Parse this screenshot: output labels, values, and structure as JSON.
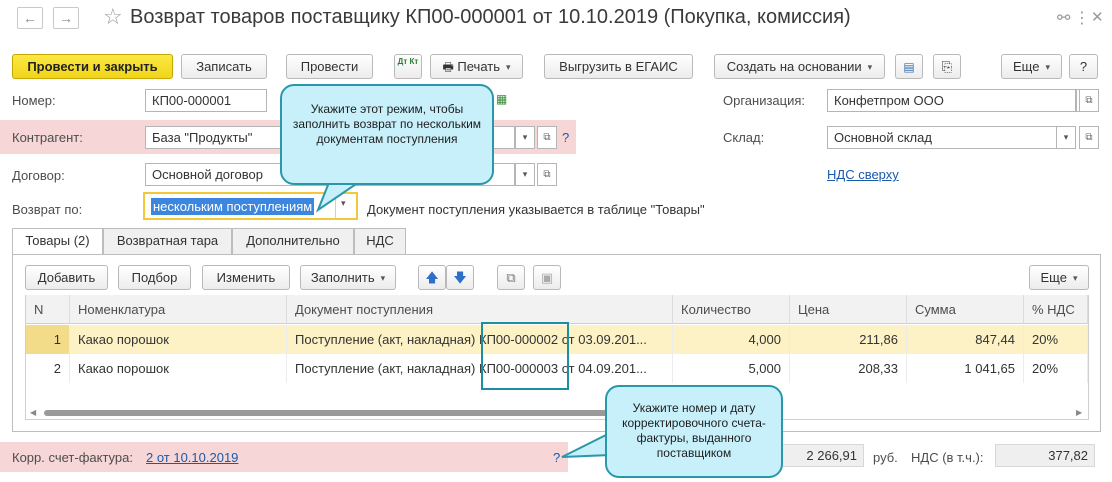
{
  "title": "Возврат товаров поставщику КП00-000001 от 10.10.2019 (Покупка, комиссия)",
  "toolbar": {
    "post_close": "Провести и закрыть",
    "save": "Записать",
    "post": "Провести",
    "dt_kt": "Дт Кт",
    "print": "Печать",
    "egais": "Выгрузить в ЕГАИС",
    "create_based": "Создать на основании",
    "more": "Еще",
    "help": "?"
  },
  "form": {
    "number_label": "Номер:",
    "number_value": "КП00-000001",
    "counterparty_label": "Контрагент:",
    "counterparty_value": "База \"Продукты\"",
    "contract_label": "Договор:",
    "contract_value": "Основной договор",
    "return_by_label": "Возврат по:",
    "return_by_value": "нескольким поступлениям",
    "return_by_hint": "Документ поступления указывается в таблице \"Товары\"",
    "org_label": "Организация:",
    "org_value": "Конфетпром ООО",
    "warehouse_label": "Склад:",
    "warehouse_value": "Основной склад",
    "vat_link": "НДС сверху"
  },
  "tabs": [
    "Товары (2)",
    "Возвратная тара",
    "Дополнительно",
    "НДС"
  ],
  "table_toolbar": {
    "add": "Добавить",
    "select": "Подбор",
    "edit": "Изменить",
    "fill": "Заполнить",
    "more": "Еще"
  },
  "table": {
    "headers": [
      "N",
      "Номенклатура",
      "Документ поступления",
      "Количество",
      "Цена",
      "Сумма",
      "% НДС"
    ],
    "rows": [
      {
        "n": "1",
        "item": "Какао порошок",
        "doc_prefix": "Поступление (акт, накладная)",
        "doc_number": "КП00-000002",
        "doc_suffix": "от 03.09.201...",
        "qty": "4,000",
        "price": "211,86",
        "sum": "847,44",
        "vat": "20%"
      },
      {
        "n": "2",
        "item": "Какао порошок",
        "doc_prefix": "Поступление (акт, накладная)",
        "doc_number": "КП00-000003",
        "doc_suffix": "от 04.09.201...",
        "qty": "5,000",
        "price": "208,33",
        "sum": "1 041,65",
        "vat": "20%"
      }
    ]
  },
  "footer": {
    "invoice_label": "Корр. счет-фактура:",
    "invoice_link": "2 от 10.10.2019",
    "question": "?",
    "total": "2 266,91",
    "currency": "руб.",
    "vat_label": "НДС (в т.ч.):",
    "vat_value": "377,82"
  },
  "callouts": {
    "top": "Укажите этот режим, чтобы заполнить возврат по нескольким документам поступления",
    "bottom": "Укажите номер и дату корректировочного счета-фактуры, выданного поставщиком"
  },
  "colors": {
    "primary_button": "#f5dc2a",
    "callout_bg": "#c7f0fa",
    "callout_border": "#2a98a8",
    "required_bg": "#f6d6d6",
    "selected_row": "#fcf2c6",
    "selection": "#3d86df"
  }
}
